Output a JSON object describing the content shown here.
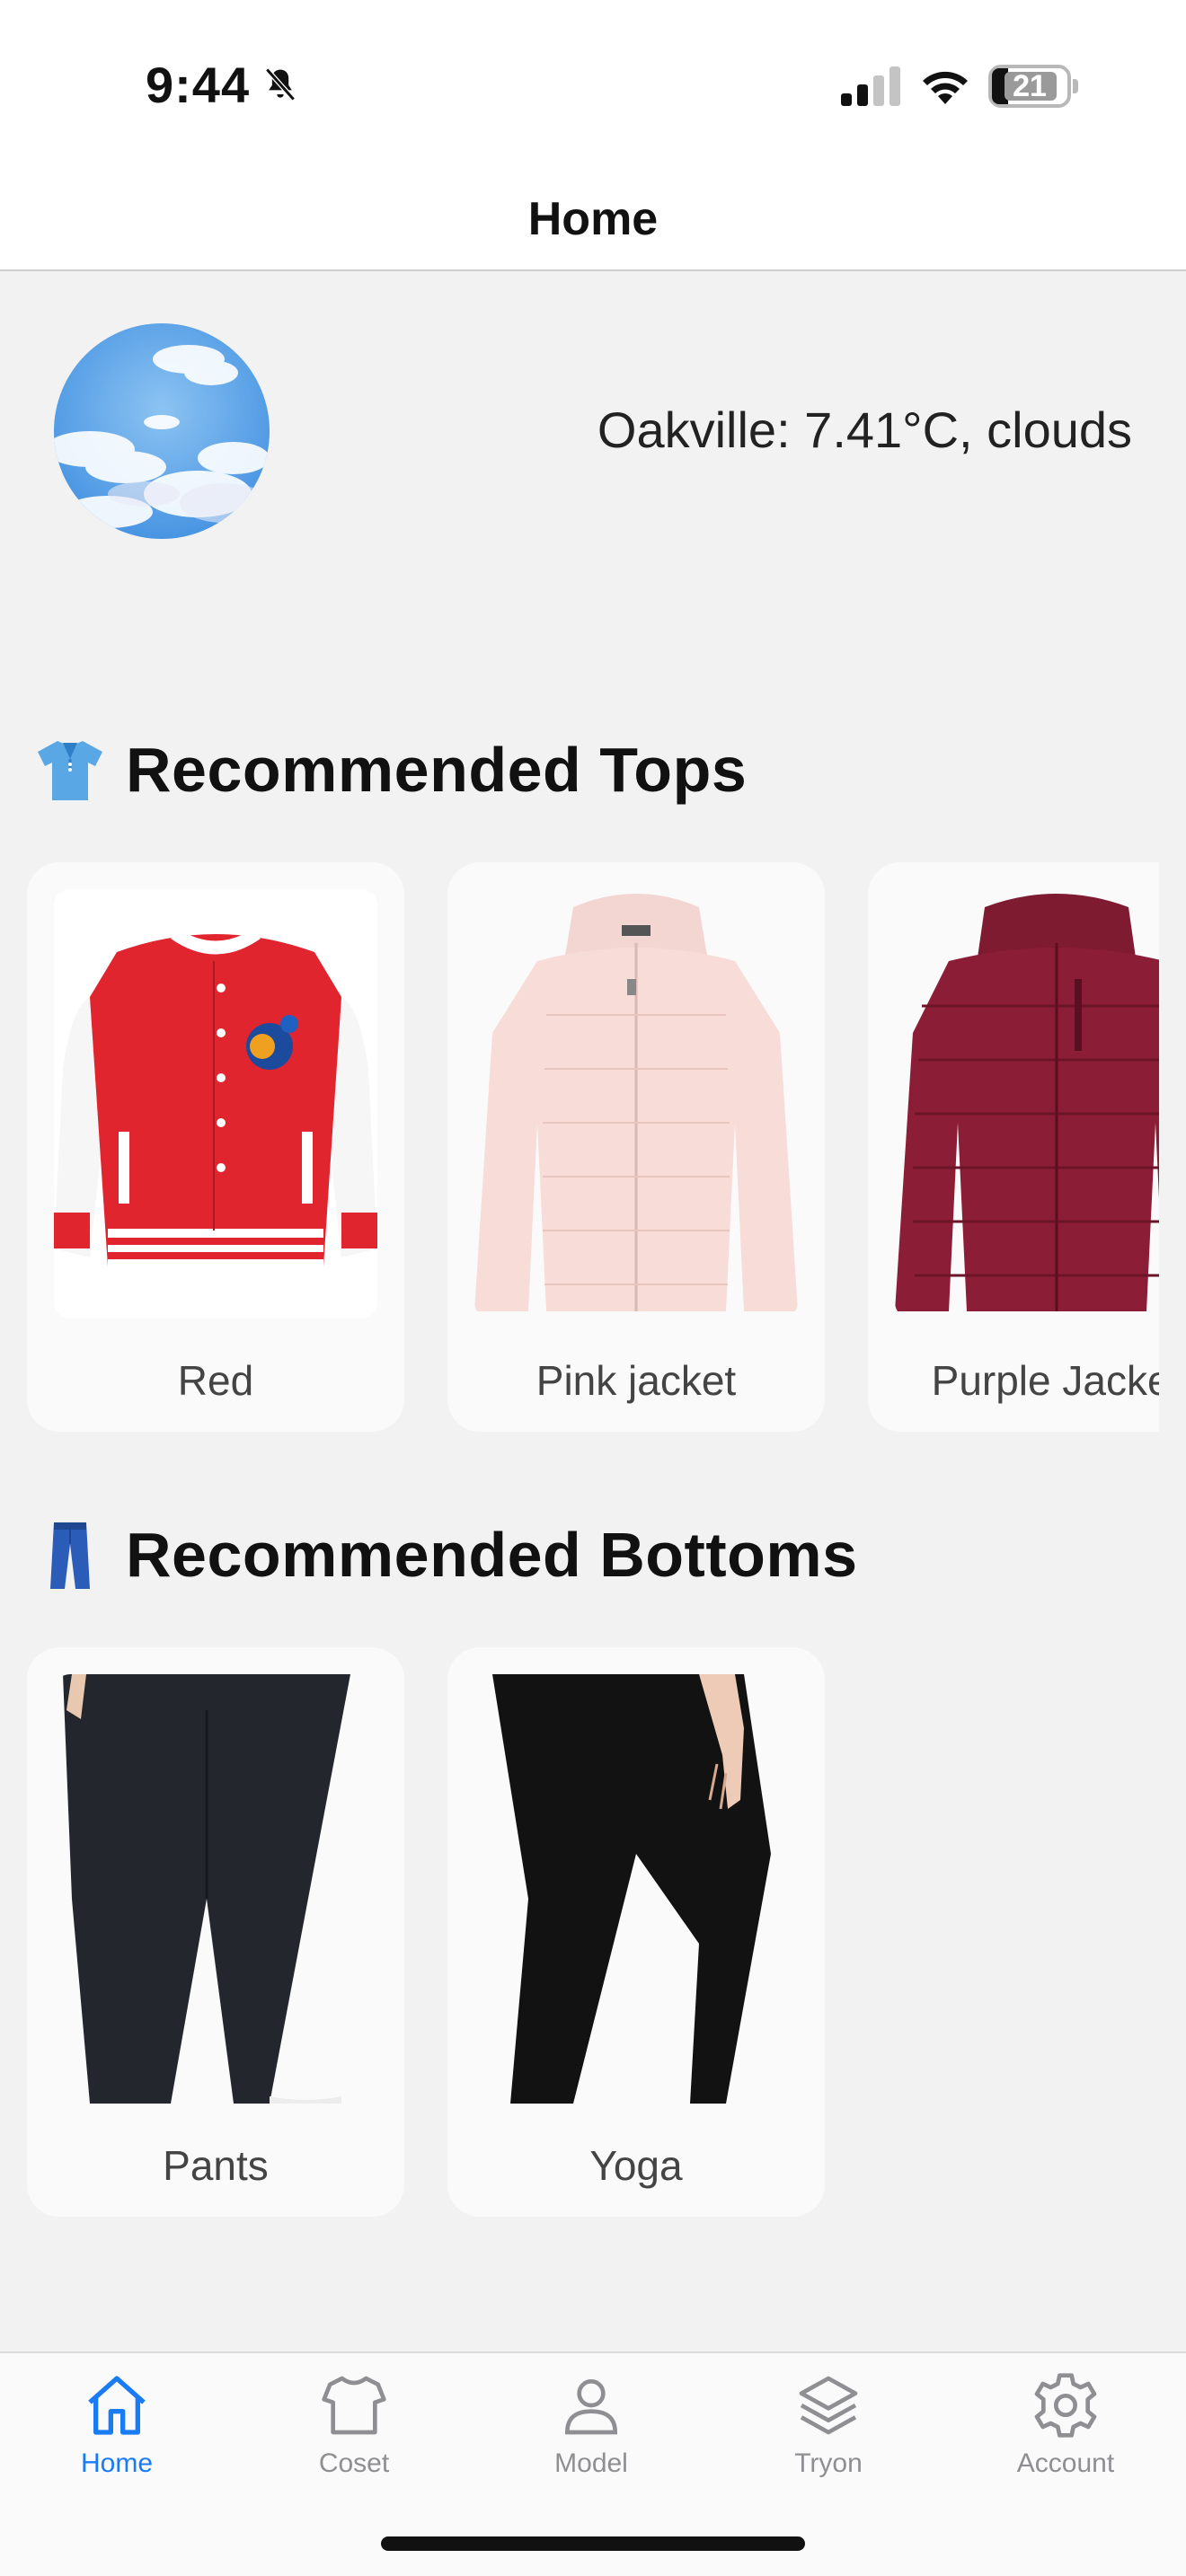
{
  "status_bar": {
    "time": "9:44",
    "battery": "21"
  },
  "nav": {
    "title": "Home"
  },
  "weather": {
    "text": "Oakville: 7.41°C, clouds"
  },
  "tops": {
    "title": "Recommended Tops",
    "items": [
      {
        "label": "Red"
      },
      {
        "label": "Pink jacket"
      },
      {
        "label": "Purple Jacket"
      }
    ]
  },
  "bottoms": {
    "title": "Recommended Bottoms",
    "items": [
      {
        "label": "Pants"
      },
      {
        "label": "Yoga"
      }
    ]
  },
  "tabbar": {
    "items": [
      {
        "label": "Home",
        "icon": "home-icon",
        "active": true
      },
      {
        "label": "Coset",
        "icon": "shirt-icon"
      },
      {
        "label": "Model",
        "icon": "person-icon"
      },
      {
        "label": "Tryon",
        "icon": "layers-icon"
      },
      {
        "label": "Account",
        "icon": "gear-icon"
      }
    ]
  },
  "colors": {
    "accent": "#1a7cf5",
    "inactive": "#8e8e93",
    "background": "#f2f2f2"
  }
}
